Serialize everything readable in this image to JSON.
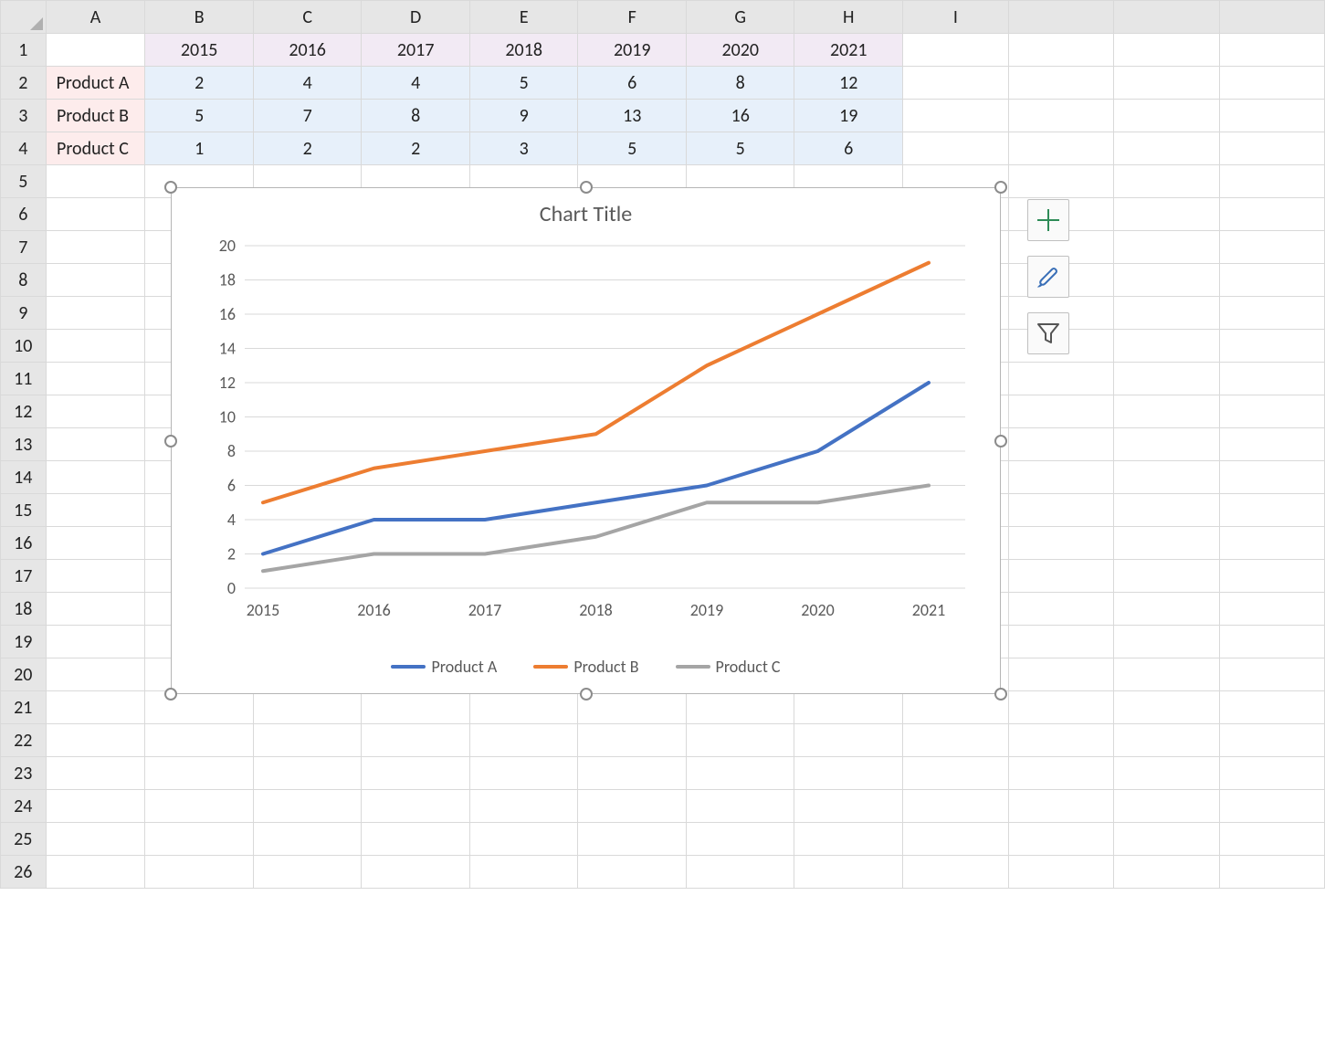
{
  "columns": [
    "A",
    "B",
    "C",
    "D",
    "E",
    "F",
    "G",
    "H",
    "I"
  ],
  "row_numbers": [
    1,
    2,
    3,
    4,
    5,
    6,
    7,
    8,
    9,
    10,
    11,
    12,
    13,
    14,
    15,
    16,
    17,
    18,
    19,
    20,
    21,
    22,
    23,
    24,
    25,
    26
  ],
  "header_years": [
    "2015",
    "2016",
    "2017",
    "2018",
    "2019",
    "2020",
    "2021"
  ],
  "row_labels": [
    "Product A",
    "Product B",
    "Product C"
  ],
  "data_rows": {
    "Product A": [
      "2",
      "4",
      "4",
      "5",
      "6",
      "8",
      "12"
    ],
    "Product B": [
      "5",
      "7",
      "8",
      "9",
      "13",
      "16",
      "19"
    ],
    "Product C": [
      "1",
      "2",
      "2",
      "3",
      "5",
      "5",
      "6"
    ]
  },
  "chart_data": {
    "type": "line",
    "title": "Chart Title",
    "categories": [
      "2015",
      "2016",
      "2017",
      "2018",
      "2019",
      "2020",
      "2021"
    ],
    "series": [
      {
        "name": "Product A",
        "values": [
          2,
          4,
          4,
          5,
          6,
          8,
          12
        ],
        "color": "#4472c4"
      },
      {
        "name": "Product B",
        "values": [
          5,
          7,
          8,
          9,
          13,
          16,
          19
        ],
        "color": "#ed7d31"
      },
      {
        "name": "Product C",
        "values": [
          1,
          2,
          2,
          3,
          5,
          5,
          6
        ],
        "color": "#a5a5a5"
      }
    ],
    "y_ticks": [
      0,
      2,
      4,
      6,
      8,
      10,
      12,
      14,
      16,
      18,
      20
    ],
    "ylim": [
      0,
      20
    ],
    "xlabel": "",
    "ylabel": ""
  },
  "legend": [
    {
      "label": "Product A",
      "color": "#4472c4"
    },
    {
      "label": "Product B",
      "color": "#ed7d31"
    },
    {
      "label": "Product C",
      "color": "#a5a5a5"
    }
  ],
  "side_buttons": {
    "add": "add-chart-element-button",
    "style": "chart-style-button",
    "filter": "chart-filter-button"
  }
}
